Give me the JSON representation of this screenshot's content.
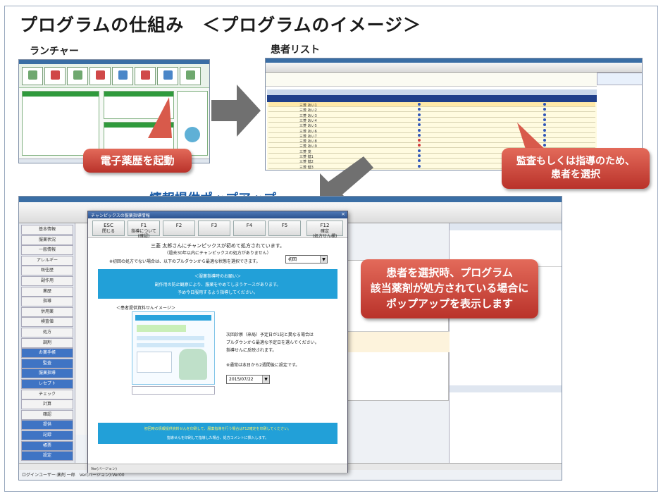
{
  "heading": "プログラムの仕組み　＜プログラムのイメージ＞",
  "labels": {
    "launcher": "ランチャー",
    "patient_list": "患者リスト",
    "popup": "情報提供ポップアップ"
  },
  "callouts": {
    "launch": "電子薬歴を起動",
    "select_line1": "監査もしくは指導のため、",
    "select_line2": "患者を選択",
    "popup_line1": "患者を選択時、プログラム",
    "popup_line2": "該当薬剤が処方されている場合に",
    "popup_line3": "ポップアップを表示します"
  },
  "dialog": {
    "title": "チャンピックスの服薬指導情報",
    "buttons": [
      {
        "key": "ESC",
        "label": "閉じる"
      },
      {
        "key": "F1",
        "label": "指導について\n(確認)"
      },
      {
        "key": "F2",
        "label": ""
      },
      {
        "key": "F3",
        "label": ""
      },
      {
        "key": "F4",
        "label": ""
      },
      {
        "key": "F5",
        "label": ""
      },
      {
        "key": "F12",
        "label": "確定\n(処方せん欄)"
      }
    ],
    "msg1": "三菱 太郎さんにチャンピックスが初めて処方されています。",
    "msg2": "（過去30年以内にチャンピックスの処方がありません）",
    "msg3": "※初回の処方でない場合は、以下のプルダウンから最適な状態を選択できます。",
    "select_value": "初回",
    "notice_title": "＜服薬指導時のお願い＞",
    "notice_body1": "副作用の防止観察により、服薬をやめてしまうケースがあります。",
    "notice_body2": "予め今日服用するよう指導してください。",
    "image_title": "＜患者提供資料せんイメージ＞",
    "right1": "次回診察（来局）予定日が1記と異なる場合は",
    "right2": "プルダウンから最適な予定日を選んでください。",
    "right3": "指導せんに反映されます。",
    "right4": "※通常は本日から2週間後に設定です。",
    "date_label": "■次回診察予定日",
    "date_value": "2015/07/22",
    "footer1": "初回時の情報提供資料せんを印刷して、服薬指導を行う場合はF12確定を印刷してください。",
    "footer2": "指導せんを印刷して指導した場合、処方コメントに挿入します。",
    "version": "Ver(バージョン)"
  },
  "ehr": {
    "sidebar": [
      "基本情報",
      "服薬状況",
      "一般情報",
      "アレルギー",
      "既往歴",
      "副作用",
      "薬歴",
      "指導",
      "併用薬",
      "検査値",
      "処方",
      "調剤",
      "お薬手帳",
      "監査",
      "服薬指導",
      "レセプト",
      "チェック",
      "計算",
      "確認",
      "提供",
      "記録",
      "帳票",
      "設定"
    ],
    "status_bar": "ログインユーザー:薬剤 一郎　Ver(バージョン):Ver00"
  },
  "list_rows": [
    "三菱 あい1",
    "三菱 あい2",
    "三菱 あい3",
    "三菱 あい4",
    "三菱 あい5",
    "三菱 あい6",
    "三菱 あい7",
    "三菱 あい8",
    "三菱 あい9",
    "三菱 茂",
    "三菱 健1",
    "三菱 健2",
    "三菱 健3"
  ]
}
